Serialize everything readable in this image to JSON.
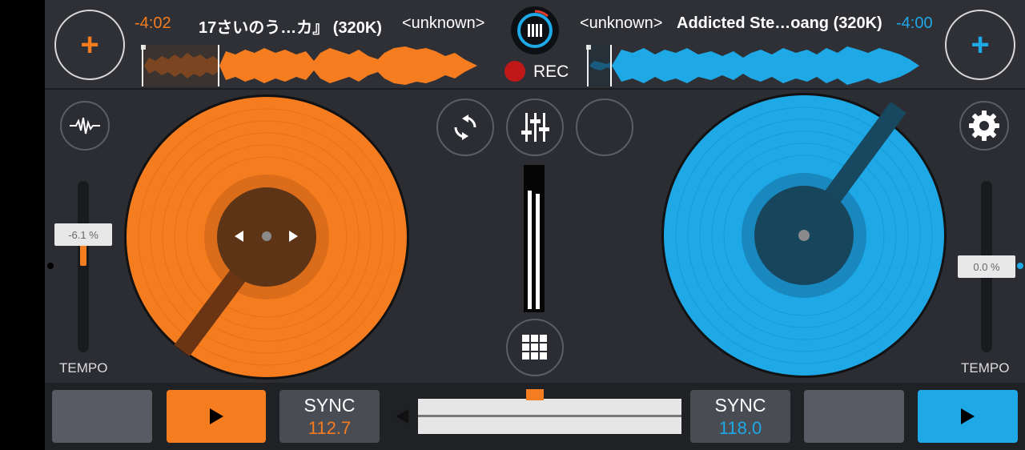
{
  "deck_a": {
    "time_remaining": "-4:02",
    "title": "17さいのう…カ』 (320K)",
    "artist": "<unknown>",
    "tempo_value": "-6.1 %",
    "tempo_label": "TEMPO",
    "sync_label": "SYNC",
    "bpm": "112.7",
    "color": "#f57c1f"
  },
  "deck_b": {
    "time_remaining": "-4:00",
    "title": "Addicted Ste…oang (320K)",
    "artist": "<unknown>",
    "tempo_value": "0.0 %",
    "tempo_label": "TEMPO",
    "sync_label": "SYNC",
    "bpm": "118.0",
    "color": "#1ea8e6"
  },
  "recorder": {
    "label": "REC",
    "color": "#c01818"
  },
  "mixer": {
    "crossfader_position": 0.5
  }
}
